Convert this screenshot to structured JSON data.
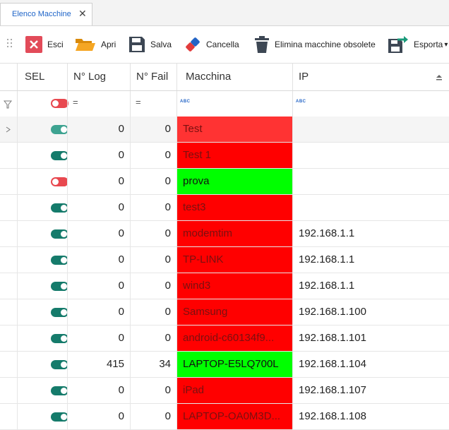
{
  "tab": {
    "label": "Elenco Macchine",
    "close": "✕"
  },
  "toolbar": {
    "esci": "Esci",
    "apri": "Apri",
    "salva": "Salva",
    "cancella": "Cancella",
    "elimina": "Elimina macchine obsolete",
    "esporta": "Esporta",
    "esporta_arrow": "▾"
  },
  "columns": {
    "sel": "SEL",
    "log": "N° Log",
    "fail": "N° Fail",
    "macchina": "Macchina",
    "ip": "IP"
  },
  "filter": {
    "log_op": "=",
    "fail_op": "=",
    "macchina_abc": "ABC",
    "ip_abc": "ABC"
  },
  "colors": {
    "red": "#ff0000",
    "green": "#00ff00",
    "red_selected": "#ff3333",
    "toggle_on": "#157b6b",
    "toggle_off": "#e8484f"
  },
  "rows": [
    {
      "sel": true,
      "log": "0",
      "fail": "0",
      "macchina": "Test",
      "ip": "",
      "color": "red"
    },
    {
      "sel": true,
      "log": "0",
      "fail": "0",
      "macchina": "Test 1",
      "ip": "",
      "color": "red"
    },
    {
      "sel": false,
      "log": "0",
      "fail": "0",
      "macchina": "prova",
      "ip": "",
      "color": "green"
    },
    {
      "sel": true,
      "log": "0",
      "fail": "0",
      "macchina": "test3",
      "ip": "",
      "color": "red"
    },
    {
      "sel": true,
      "log": "0",
      "fail": "0",
      "macchina": "modemtim",
      "ip": "192.168.1.1",
      "color": "red"
    },
    {
      "sel": true,
      "log": "0",
      "fail": "0",
      "macchina": "TP-LINK",
      "ip": "192.168.1.1",
      "color": "red"
    },
    {
      "sel": true,
      "log": "0",
      "fail": "0",
      "macchina": "wind3",
      "ip": "192.168.1.1",
      "color": "red"
    },
    {
      "sel": true,
      "log": "0",
      "fail": "0",
      "macchina": "Samsung",
      "ip": "192.168.1.100",
      "color": "red"
    },
    {
      "sel": true,
      "log": "0",
      "fail": "0",
      "macchina": "android-c60134f9...",
      "ip": "192.168.1.101",
      "color": "red"
    },
    {
      "sel": true,
      "log": "415",
      "fail": "34",
      "macchina": "LAPTOP-E5LQ700L",
      "ip": "192.168.1.104",
      "color": "green"
    },
    {
      "sel": true,
      "log": "0",
      "fail": "0",
      "macchina": "iPad",
      "ip": "192.168.1.107",
      "color": "red"
    },
    {
      "sel": true,
      "log": "0",
      "fail": "0",
      "macchina": "LAPTOP-OA0M3D...",
      "ip": "192.168.1.108",
      "color": "red"
    }
  ]
}
